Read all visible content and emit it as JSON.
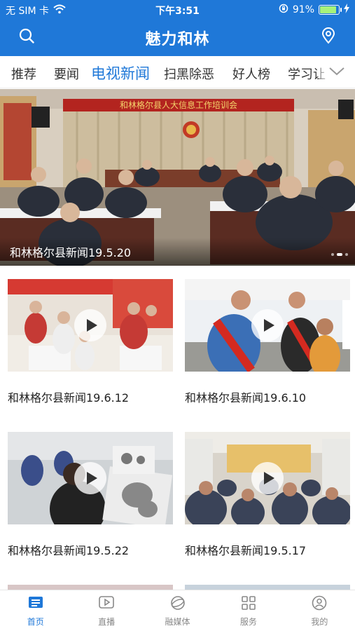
{
  "status_bar": {
    "carrier": "无 SIM 卡",
    "time": "下午3:51",
    "battery": "91%",
    "battery_level": 0.91
  },
  "header": {
    "title": "魅力和林",
    "search_icon": "search-icon",
    "location_icon": "location-pin-icon"
  },
  "tabs": {
    "items": [
      {
        "label": "推荐"
      },
      {
        "label": "要闻"
      },
      {
        "label": "电视新闻",
        "active": true
      },
      {
        "label": "扫黑除恶"
      },
      {
        "label": "好人榜"
      },
      {
        "label": "学习让"
      }
    ],
    "more_icon": "chevron-down-icon"
  },
  "banner": {
    "caption": "和林格尔县新闻19.5.20",
    "slide_count": 3,
    "active_slide": 2,
    "scene_text": "和林格尔县人大信息工作培训会"
  },
  "videos": [
    {
      "title": "和林格尔县新闻19.6.12"
    },
    {
      "title": "和林格尔县新闻19.6.10"
    },
    {
      "title": "和林格尔县新闻19.5.22"
    },
    {
      "title": "和林格尔县新闻19.5.17"
    }
  ],
  "bottom_nav": {
    "items": [
      {
        "label": "首页",
        "icon": "home-icon",
        "active": true
      },
      {
        "label": "直播",
        "icon": "live-play-icon"
      },
      {
        "label": "融媒体",
        "icon": "media-globe-icon"
      },
      {
        "label": "服务",
        "icon": "grid-services-icon"
      },
      {
        "label": "我的",
        "icon": "user-profile-icon"
      }
    ]
  },
  "colors": {
    "brand": "#1f78d8",
    "nav_inactive": "#888888"
  }
}
